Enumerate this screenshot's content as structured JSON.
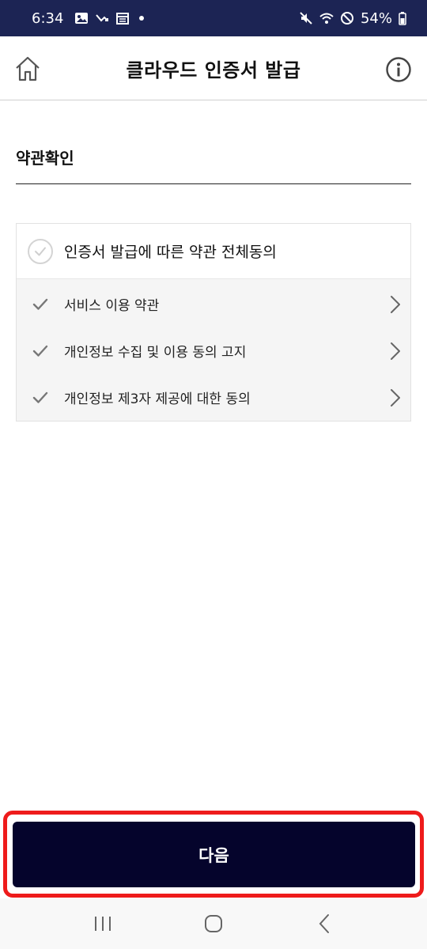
{
  "status_bar": {
    "time": "6:34",
    "battery": "54%",
    "icons": [
      "image-icon",
      "missed-call-icon",
      "calendar-icon",
      "dot-icon",
      "mute-icon",
      "wifi-icon",
      "do-not-disturb-icon",
      "battery-icon"
    ]
  },
  "header": {
    "title": "클라우드 인증서 발급",
    "home_icon": "home-icon",
    "info_icon": "info-icon"
  },
  "section": {
    "title": "약관확인"
  },
  "terms": {
    "all_agree_label": "인증서 발급에 따른 약관 전체동의",
    "items": [
      {
        "label": "서비스 이용 약관"
      },
      {
        "label": "개인정보 수집 및 이용 동의 고지"
      },
      {
        "label": "개인정보 제3자 제공에 대한 동의"
      }
    ]
  },
  "footer": {
    "next_label": "다음",
    "highlight_color": "#ee1b1b",
    "button_color": "#05042c"
  },
  "nav_bar": {
    "icons": [
      "recent-apps-icon",
      "home-nav-icon",
      "back-icon"
    ]
  }
}
